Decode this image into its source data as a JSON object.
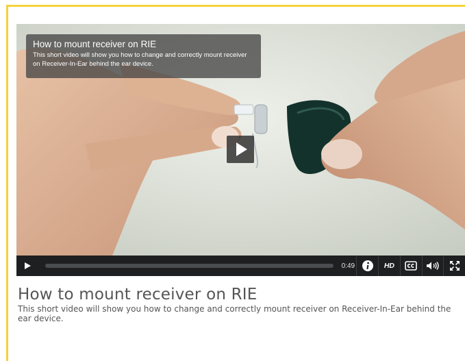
{
  "video": {
    "overlay_title": "How to mount receiver on RIE",
    "overlay_description": "This short video will show you how to change and correctly mount receiver on Receiver-In-Ear behind the ear device.",
    "time": "0:49",
    "progress": 0,
    "hd_label": "HD",
    "icons": [
      "play-icon",
      "info-icon",
      "closed-captions-icon",
      "volume-icon",
      "fullscreen-icon"
    ]
  },
  "page": {
    "title": "How to mount receiver on RIE",
    "description": "This short video will show you how to change and correctly mount receiver on Receiver-In-Ear behind the ear device."
  },
  "colors": {
    "frame_border": "#f5d33a",
    "controls_bg": "#1d1f21",
    "text_gray": "#555555"
  }
}
